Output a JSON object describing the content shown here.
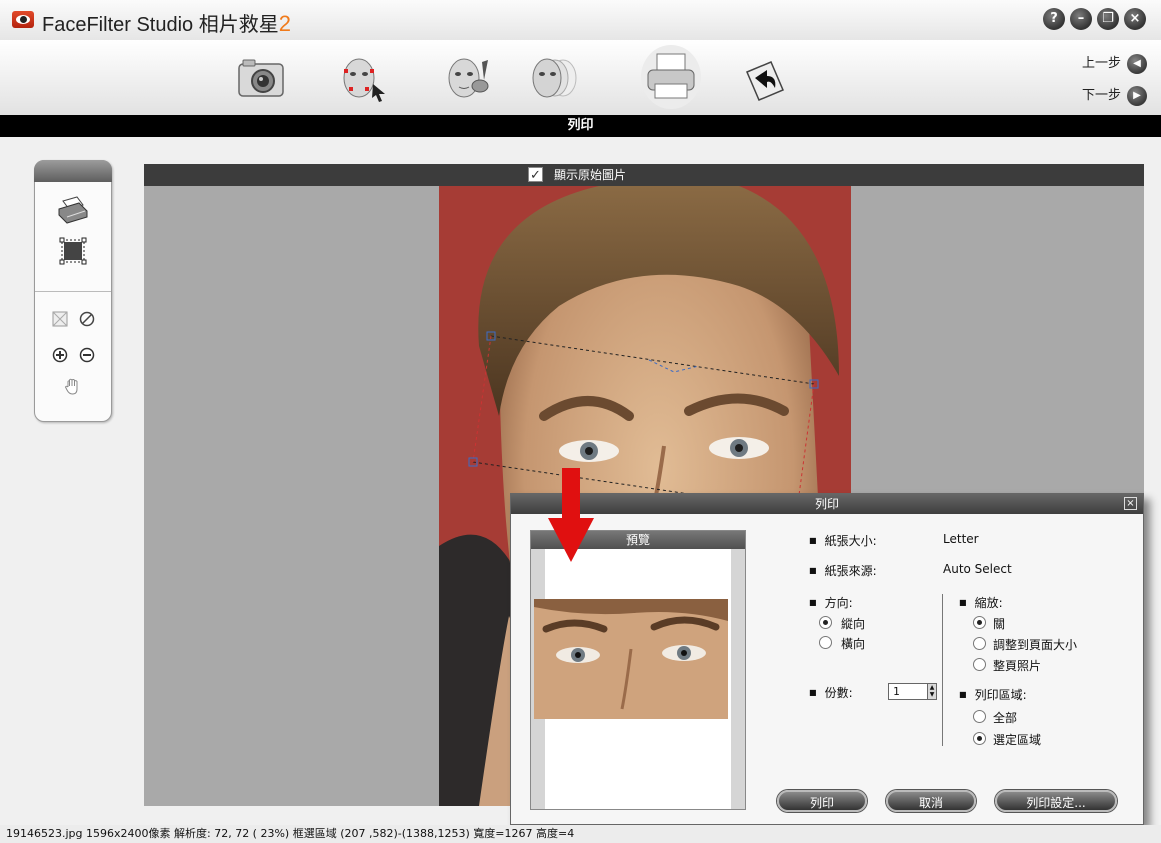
{
  "app": {
    "title": "FaceFilter Studio 相片救星",
    "version": "2"
  },
  "window_buttons": [
    {
      "name": "help",
      "glyph": "?"
    },
    {
      "name": "minimize",
      "glyph": "–"
    },
    {
      "name": "restore",
      "glyph": "❐"
    },
    {
      "name": "close",
      "glyph": "×"
    }
  ],
  "toolbar": {
    "tools": [
      "camera-icon",
      "face-select-icon",
      "face-edit-icon",
      "face-morph-icon",
      "printer-icon",
      "export-icon"
    ],
    "prev_step": "上一步",
    "next_step": "下一步"
  },
  "step_title": "列印",
  "view": {
    "show_original_label": "顯示原始圖片",
    "show_original_checked": true
  },
  "palette": [
    "print-tool-icon",
    "select-area-icon",
    "fit-icon",
    "clear-icon",
    "zoom-in-icon",
    "zoom-out-icon",
    "hand-icon"
  ],
  "print_dialog": {
    "title": "列印",
    "preview_label": "預覽",
    "paper_size_label": "紙張大小:",
    "paper_size_value": "Letter",
    "paper_source_label": "紙張來源:",
    "paper_source_value": "Auto Select",
    "orientation_label": "方向:",
    "orientation_options": [
      {
        "label": "縱向",
        "selected": true
      },
      {
        "label": "橫向",
        "selected": false
      }
    ],
    "scale_label": "縮放:",
    "scale_options": [
      {
        "label": "關",
        "selected": true
      },
      {
        "label": "調整到頁面大小",
        "selected": false
      },
      {
        "label": "整頁照片",
        "selected": false
      }
    ],
    "copies_label": "份數:",
    "copies_value": "1",
    "print_area_label": "列印區域:",
    "print_area_options": [
      {
        "label": "全部",
        "selected": false
      },
      {
        "label": "選定區域",
        "selected": true
      }
    ],
    "buttons": {
      "print": "列印",
      "cancel": "取消",
      "print_setup": "列印設定..."
    }
  },
  "status_bar": "19146523.jpg   1596x2400像素  解析度: 72, 72 ( 23%)   框選區域 (207 ,582)-(1388,1253) 寬度=1267  高度=4",
  "colors": {
    "accent": "#f07a1a",
    "photo_bg": "#a63c35",
    "arrow": "#e01010"
  }
}
